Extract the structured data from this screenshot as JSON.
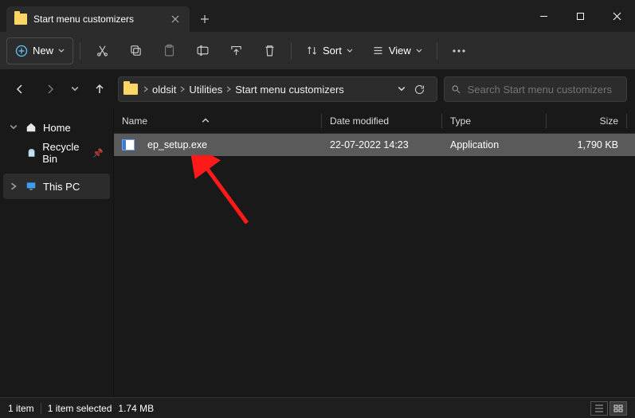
{
  "tab": {
    "title": "Start menu customizers"
  },
  "toolbar": {
    "new": "New",
    "sort": "Sort",
    "view": "View"
  },
  "breadcrumbs": [
    "oldsit",
    "Utilities",
    "Start menu customizers"
  ],
  "search": {
    "placeholder": "Search Start menu customizers"
  },
  "sidebar": {
    "home": "Home",
    "recycle": "Recycle Bin",
    "thispc": "This PC"
  },
  "columns": {
    "name": "Name",
    "date": "Date modified",
    "type": "Type",
    "size": "Size"
  },
  "rows": [
    {
      "name": "ep_setup.exe",
      "date": "22-07-2022 14:23",
      "type": "Application",
      "size": "1,790 KB"
    }
  ],
  "status": {
    "count": "1 item",
    "selected": "1 item selected",
    "size": "1.74 MB"
  }
}
